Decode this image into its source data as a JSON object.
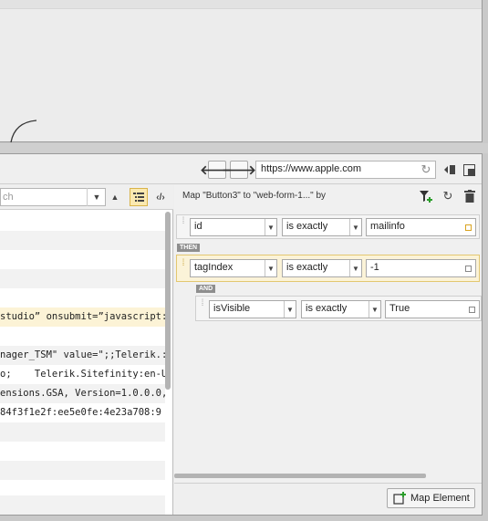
{
  "browser": {
    "back_icon": "arrow-left-icon",
    "forward_icon": "arrow-right-icon",
    "url": "https://www.apple.com",
    "refresh_icon": "refresh-icon",
    "split_icon": "split-view-icon",
    "popout_icon": "popout-icon"
  },
  "dom_panel": {
    "search_placeholder": "ch",
    "lines": [
      "",
      "",
      "",
      "",
      "",
      "studio” onsubmit=”javascript:",
      "",
      "nager_TSM\" value=\";;Telerik.:",
      "o;    Telerik.Sitefinity:en-U",
      "ensions.GSA, Version=1.0.0.0,",
      "84f3f1e2f:ee5e0fe:4e23a708:9",
      "",
      "",
      "",
      "",
      ""
    ]
  },
  "mapping": {
    "title": "Map \"Button3\" to \"web-form-1...\" by",
    "rule1": {
      "attr": "id",
      "op": "is exactly",
      "value": "mailinfo"
    },
    "then_label": "THEN",
    "rule2": {
      "attr": "tagIndex",
      "op": "is exactly",
      "value": "-1"
    },
    "and_label": "AND",
    "rule3": {
      "attr": "isVisible",
      "op": "is exactly",
      "value": "True"
    },
    "map_element_label": "Map Element"
  }
}
